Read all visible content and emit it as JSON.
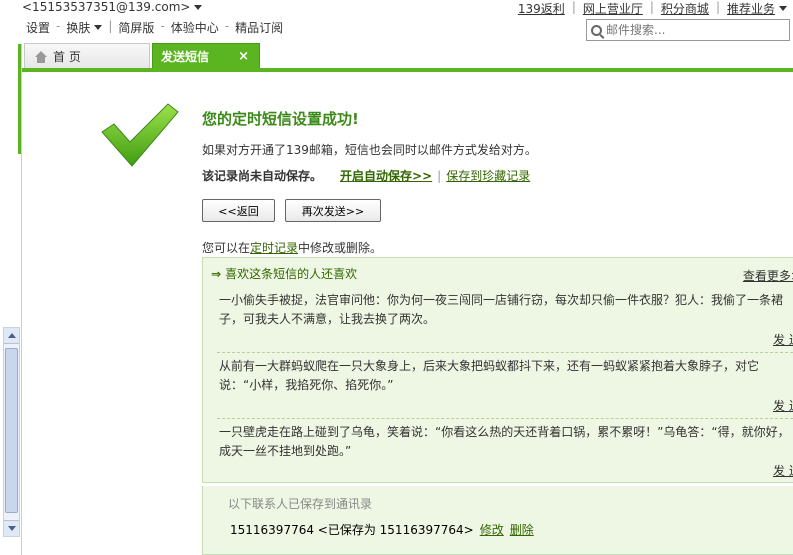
{
  "header": {
    "email": "<15153537351@139.com>",
    "top_links": [
      "139返利",
      "网上营业厅",
      "积分商城",
      "推荐业务"
    ],
    "nav": [
      "设置",
      "换肤",
      "简屏版",
      "体验中心",
      "精品订阅"
    ],
    "search_placeholder": "邮件搜索..."
  },
  "tabs": {
    "home": "首 页",
    "active": "发送短信",
    "close": "×"
  },
  "success": {
    "title": "您的定时短信设置成功!",
    "desc": "如果对方开通了139邮箱，短信也会同时以邮件方式发给对方。",
    "record_note": "该记录尚未自动保存。",
    "auto_save_link": "开启自动保存>>",
    "save_link": "保存到珍藏记录",
    "back_button": "<<返回",
    "resend_button": "再次发送>>",
    "edit_prefix": "您可以在",
    "edit_link": "定时记录",
    "edit_suffix": "中修改或删除。"
  },
  "recommend": {
    "heading": "喜欢这条短信的人还喜欢",
    "more": "查看更多>>",
    "send_label": "发送",
    "jokes": [
      "一小偷失手被捉，法官审问他：你为何一夜三闯同一店铺行窃，每次却只偷一件衣服？犯人：我偷了一条裙子，可我夫人不满意，让我去换了两次。",
      "从前有一大群蚂蚁爬在一只大象身上，后来大象把蚂蚁都抖下来，还有一蚂蚁紧紧抱着大象脖子，对它说：“小样，我掐死你、掐死你。”",
      "一只壁虎走在路上碰到了乌龟，笑着说：“你看这么热的天还背着口锅，累不累呀！”乌龟答：“得，就你好，成天一丝不挂地到处跑。”"
    ]
  },
  "contacts": {
    "header": "以下联系人已保存到通讯录",
    "entry": "15116397764 <已保存为 15116397764>",
    "edit": "修改",
    "delete": "删除"
  },
  "colors": {
    "accent_green": "#5ab521",
    "title_green": "#3c8a1a",
    "panel_bg": "#eef7e3"
  }
}
